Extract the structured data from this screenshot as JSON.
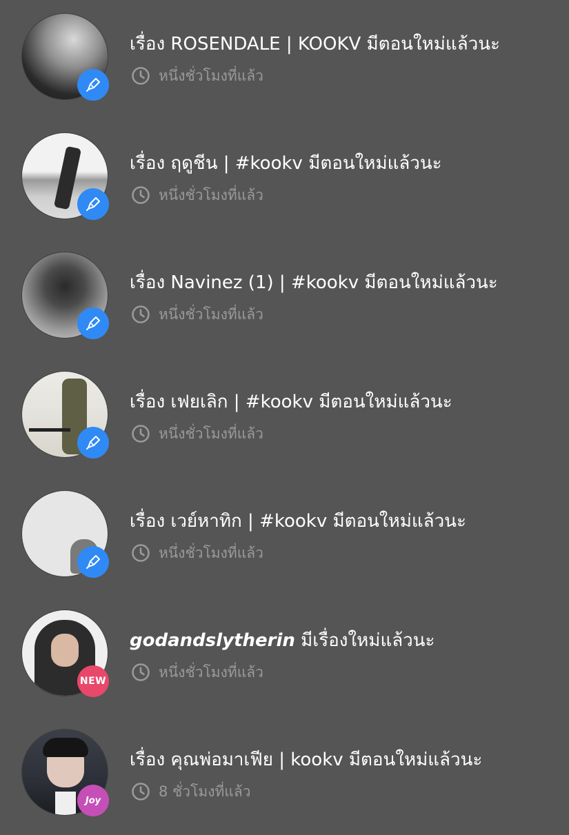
{
  "notifications": [
    {
      "title": "เรื่อง ROSENDALE | KOOKV  มีตอนใหม่แล้วนะ",
      "time": "หนึ่งชั่วโมงที่แล้ว",
      "badge": "pen",
      "avatar_icon": "avatar-photo"
    },
    {
      "title": "เรื่อง ฤดูชีน | #kookv มีตอนใหม่แล้วนะ",
      "time": "หนึ่งชั่วโมงที่แล้ว",
      "badge": "pen",
      "avatar_icon": "avatar-photo"
    },
    {
      "title": "เรื่อง Navinez (1) | #kookv มีตอนใหม่แล้วนะ",
      "time": "หนึ่งชั่วโมงที่แล้ว",
      "badge": "pen",
      "avatar_icon": "avatar-photo"
    },
    {
      "title": "เรื่อง เฟยเลิก | #kookv มีตอนใหม่แล้วนะ",
      "time": "หนึ่งชั่วโมงที่แล้ว",
      "badge": "pen",
      "avatar_icon": "avatar-photo"
    },
    {
      "title": "เรื่อง  เวย์หาทิก | #kookv มีตอนใหม่แล้วนะ",
      "time": "หนึ่งชั่วโมงที่แล้ว",
      "badge": "pen",
      "avatar_icon": "avatar-photo"
    },
    {
      "username": "godandslytherin",
      "title": " มีเรื่องใหม่แล้วนะ",
      "time": "หนึ่งชั่วโมงที่แล้ว",
      "badge": "new",
      "badge_text": "NEW",
      "avatar_icon": "avatar-photo"
    },
    {
      "title": "เรื่อง คุณพ่อมาเฟีย | kookv มีตอนใหม่แล้วนะ",
      "time": "8 ชั่วโมงที่แล้ว",
      "badge": "joy",
      "badge_text": "Joy",
      "avatar_icon": "avatar-photo"
    }
  ],
  "colors": {
    "background": "#555555",
    "title_text": "#ffffff",
    "meta_text": "#9a9a9a",
    "pen_badge": "#2f8af5",
    "new_badge": "#e8486a",
    "joy_badge": "#c54fb7"
  },
  "icons": {
    "clock": "clock-icon",
    "pen": "pen-icon"
  }
}
